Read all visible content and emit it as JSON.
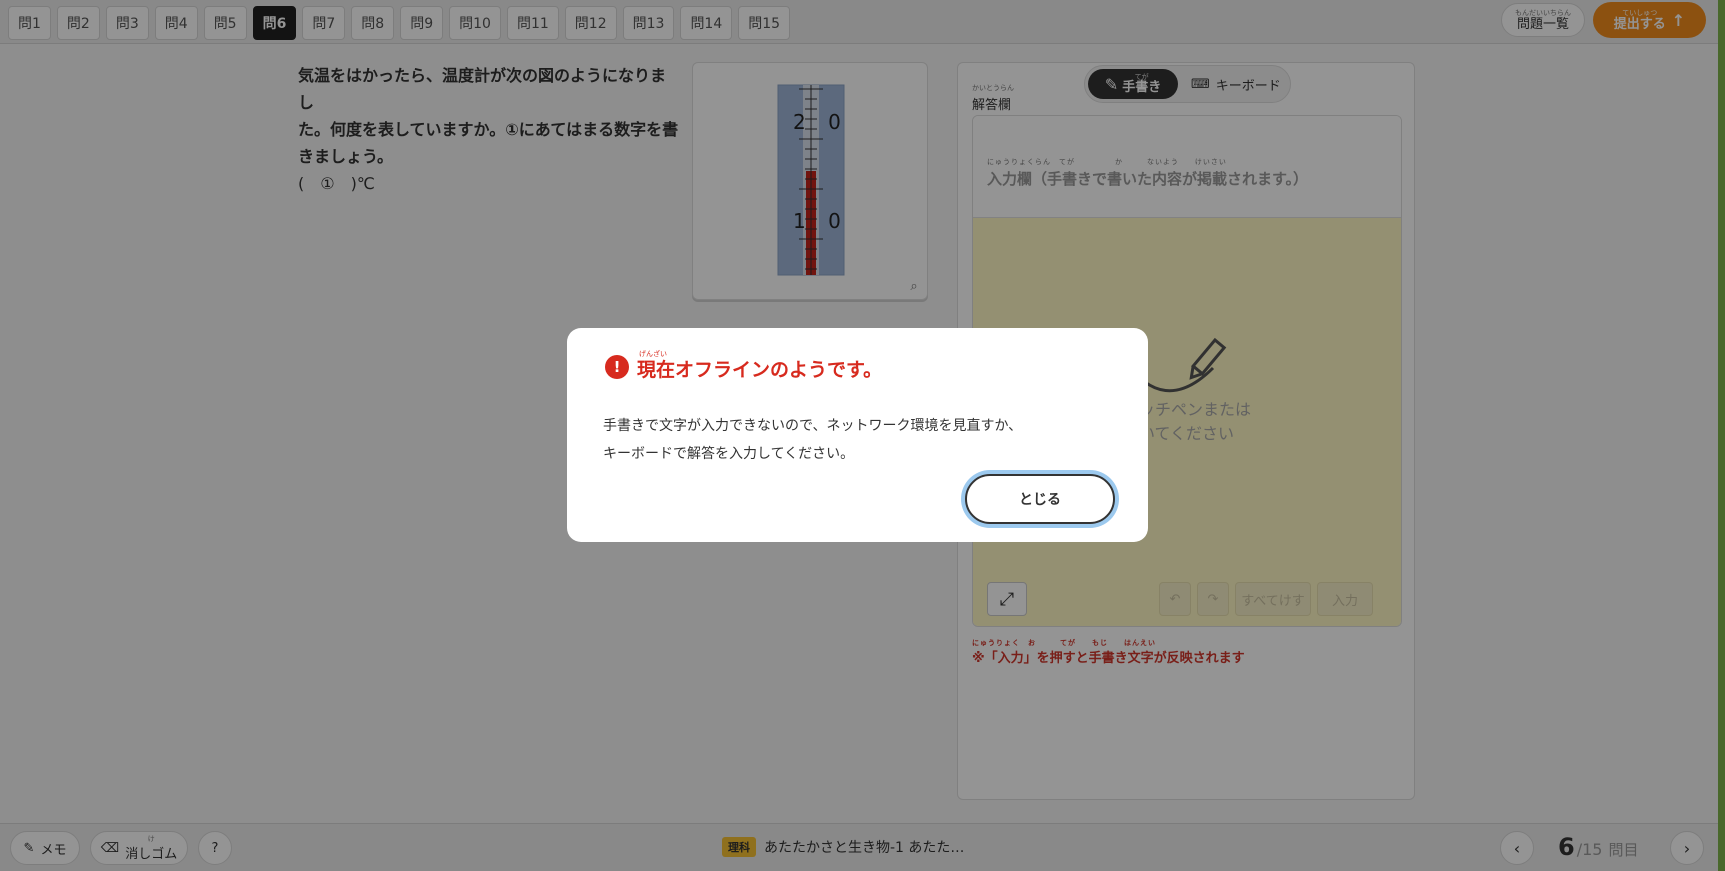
{
  "tabs": [
    "問1",
    "問2",
    "問3",
    "問4",
    "問5",
    "問6",
    "問7",
    "問8",
    "問9",
    "問10",
    "問11",
    "問12",
    "問13",
    "問14",
    "問15"
  ],
  "header": {
    "list_ruby": "もんだいいちらん",
    "list_label": "問題一覧",
    "submit_ruby": "ていしゅつ",
    "submit_label": "提出する",
    "submit_color": "#f28c1c"
  },
  "question": {
    "text_line1": "気温をはかったら、温度計が次の図のようになりまし",
    "text_line2": "た。何度を表していますか。①にあてはまる数字を書",
    "text_line3": "きましょう。",
    "blank": "(　①　)℃"
  },
  "figure": {
    "thermometer_label_top": "2 0",
    "thermometer_label_bottom": "1 0",
    "zoom_icon": "zoom-icon"
  },
  "answer": {
    "title_ruby": "かいとうらん",
    "title": "解答欄",
    "mode_hand_ruby": "てが",
    "mode_hand": "手書き",
    "mode_keyboard": "キーボード",
    "input_ruby": "にゅうりょくらん　てが　　　　　か　　　ないよう　　けいさい",
    "input_label": "入力欄（手書きで書いた内容が掲載されます。）",
    "hint_line1": "タッチペンまたは",
    "hint_line2": "書いてください",
    "btn_erase_all": "すべてけす",
    "btn_input": "入力",
    "note_ruby": "にゅうりょく　お　　　てが　　もじ　　はんえい",
    "note": "※「入力」を押すと手書き文字が反映されます"
  },
  "bottom": {
    "memo": "メモ",
    "eraser_ruby": "け",
    "eraser": "消しゴム",
    "help": "?",
    "subject_tag": "理科",
    "subject_title": "あたたかさと生き物-1 あたた…",
    "page_current": "6",
    "page_total": "/15",
    "page_unit": "問目"
  },
  "dialog": {
    "title_ruby": "げんざい",
    "title": "現在オフラインのようです。",
    "msg_line1": "手書きで文字が入力できないので、ネットワーク環境を見直すか、",
    "msg_line2": "キーボードで解答を入力してください。",
    "close": "とじる",
    "error_color": "#d72a1e"
  }
}
